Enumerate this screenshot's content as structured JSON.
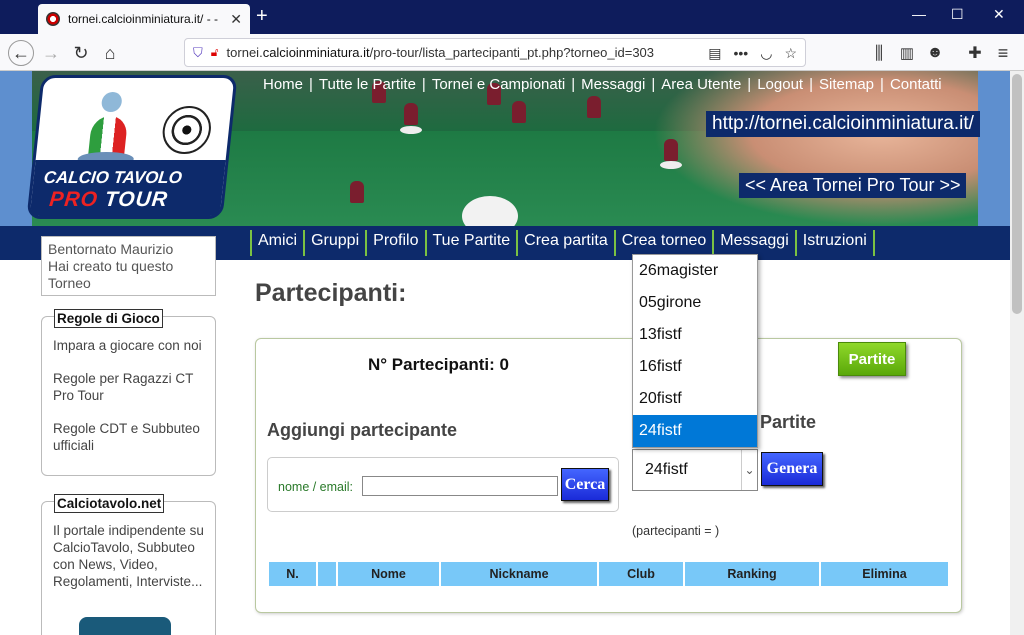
{
  "browser": {
    "tab_title": "tornei.calcioinminiatura.it/ - -",
    "url_prefix": "tornei.",
    "url_domain": "calcioinminiatura.it",
    "url_path": "/pro-tour/lista_partecipanti_pt.php?torneo_id=303"
  },
  "header": {
    "logo_line1": "CALCIO TAVOLO",
    "logo_pro": "PRO",
    "logo_tour": "TOUR",
    "top_menu": [
      "Home",
      "Tutte le Partite",
      "Tornei e Campionati",
      "Messaggi",
      "Area Utente",
      "Logout",
      "Sitemap",
      "Contatti"
    ],
    "site_url": "http://tornei.calcioinminiatura.it/",
    "area_link": "<< Area Tornei Pro Tour >>"
  },
  "main_menu": [
    "Amici",
    "Gruppi",
    "Profilo",
    "Tue Partite",
    "Crea partita",
    "Crea torneo",
    "Messaggi",
    "Istruzioni"
  ],
  "sidebar": {
    "user_name": "Bentornato Maurizio",
    "user_note": "Hai creato tu questo Torneo",
    "rules_title": "Regole di Gioco",
    "rules_items": [
      "Impara a giocare con noi",
      "Regole per Ragazzi CT Pro Tour",
      "Regole CDT e Subbuteo ufficiali"
    ],
    "ct_title": "Calciotavolo.net",
    "ct_text": "Il portale indipendente su CalcioTavolo, Subbuteo con News, Video, Regolamenti, Interviste..."
  },
  "main": {
    "page_title": "Partecipanti:",
    "n_partecipanti": "N° Partecipanti: 0",
    "partite_button": "Partite",
    "aggiungi_title": "Aggiungi partecipante",
    "search_label": "nome / email:",
    "search_value": "",
    "search_button": "Cerca",
    "genera_title": "na Partite",
    "select_value": "24fistf",
    "genera_button": "Genera",
    "partecipanti_note": "(partecipanti = )",
    "dropdown_options": [
      "26magister",
      "05girone",
      "13fistf",
      "16fistf",
      "20fistf",
      "24fistf"
    ],
    "dropdown_selected": 5,
    "table_headers": [
      "N.",
      "",
      "Nome",
      "Nickname",
      "Club",
      "Ranking",
      "Elimina"
    ]
  },
  "colors": {
    "navy": "#0d2a6b",
    "menu_border": "#7ac143",
    "table_header": "#78c8f8",
    "button_green": "#5aa80a",
    "button_blue": "#1a2ad8",
    "dropdown_selected": "#0078d7"
  }
}
